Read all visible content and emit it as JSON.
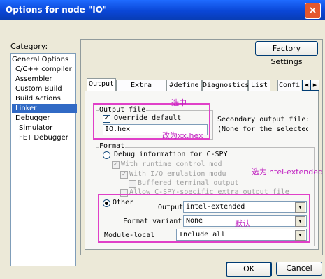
{
  "window": {
    "title": "Options for node \"IO\"",
    "close_glyph": "×"
  },
  "category": {
    "label": "Category:",
    "items": [
      "General Options",
      "C/C++ compiler",
      "Assembler",
      "Custom Build",
      "Build Actions",
      "Linker",
      "Debugger",
      "Simulator",
      "FET Debugger"
    ],
    "selected": "Linker"
  },
  "buttons": {
    "factory": "Factory Settings",
    "ok": "OK",
    "cancel": "Cancel"
  },
  "tabs": [
    "Output",
    "Extra Output",
    "#define",
    "Diagnostics",
    "List",
    "Confi"
  ],
  "output_file": {
    "group_title": "Output file",
    "override_label": "Override default",
    "override_checked": true,
    "filename": "IO.hex",
    "secondary_label": "Secondary output file:",
    "secondary_value": "(None for the selected fo"
  },
  "format": {
    "group_title": "Format",
    "debug_label": "Debug information for C-SPY",
    "runtime_label": "With runtime control mod",
    "io_label": "With I/O emulation modu",
    "buffered_label": "Buffered terminal output",
    "allow_label": "Allow C-SPY-specific extra output file",
    "other_label": "Other",
    "output_label": "Output",
    "output_value": "intel-extended",
    "variant_label": "Format variant:",
    "variant_value": "None",
    "module_label": "Module-local",
    "module_value": "Include all"
  },
  "annotations": {
    "checked": "选中",
    "rename": "改为xx.hex",
    "select_intel": "选为intel-extended",
    "default": "默认"
  },
  "colors": {
    "annotation": "#e040c8",
    "title_bar": "#0a46d6",
    "selection": "#316ac5"
  }
}
